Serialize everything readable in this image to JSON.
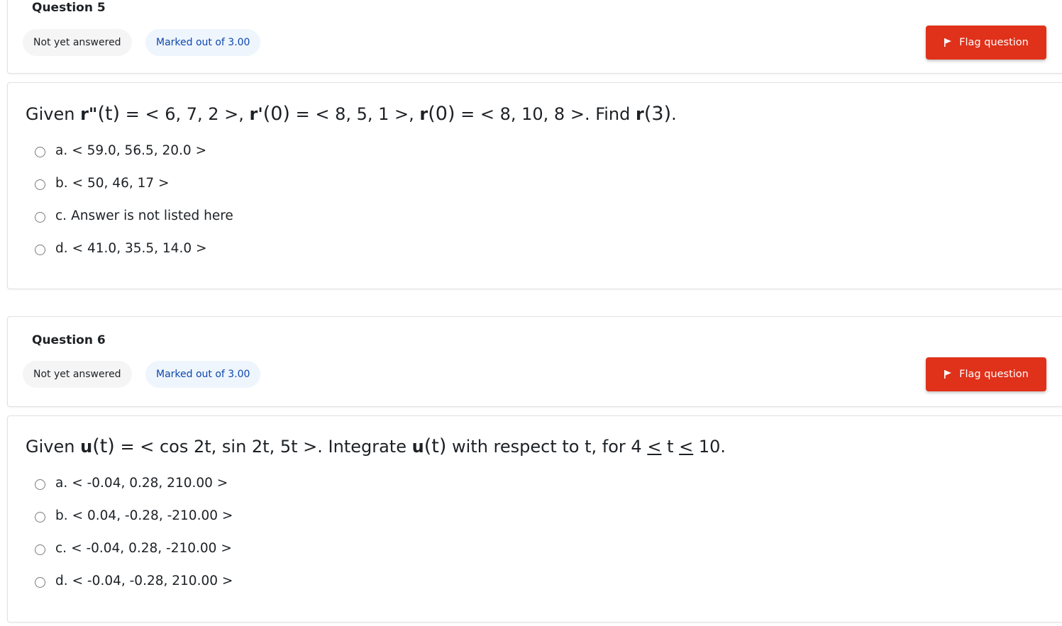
{
  "q5": {
    "title": "Question 5",
    "state": "Not yet answered",
    "marks": "Marked out of 3.00",
    "flag_label": "Flag question",
    "text": {
      "given": "Given",
      "r2": "r\"",
      "t1": "(t)",
      "eq1": " = < 6, 7, 2 >,",
      "r1": "r'",
      "t2": "(0)",
      "eq2": " = < 8, 5, 1 >,",
      "r0": "r",
      "t3": "(0)",
      "eq3": " = < 8, 10, 8 >. Find",
      "r3": "r",
      "t4": "(3)",
      "end": "."
    },
    "options": [
      {
        "letter": "a.",
        "text": "< 59.0, 56.5, 20.0 >"
      },
      {
        "letter": "b.",
        "text": "< 50, 46, 17 >"
      },
      {
        "letter": "c.",
        "text": "Answer is not listed here"
      },
      {
        "letter": "d.",
        "text": "< 41.0, 35.5, 14.0 >"
      }
    ]
  },
  "q6": {
    "title": "Question 6",
    "state": "Not yet answered",
    "marks": "Marked out of 3.00",
    "flag_label": "Flag question",
    "text": {
      "given": "Given",
      "u1": "u",
      "t1": "(t)",
      "eq1": " = < cos 2t, sin 2t, 5t >. Integrate",
      "u2": "u",
      "t2": "(t)",
      "mid": " with respect to t, for 4",
      "le1": "<",
      "tt": "t",
      "le2": "<",
      "end": "10."
    },
    "options": [
      {
        "letter": "a.",
        "text": "< -0.04, 0.28, 210.00 >"
      },
      {
        "letter": "b.",
        "text": "< 0.04, -0.28, -210.00 >"
      },
      {
        "letter": "c.",
        "text": "< -0.04, 0.28, -210.00 >"
      },
      {
        "letter": "d.",
        "text": "< -0.04, -0.28, 210.00 >"
      }
    ]
  },
  "colors": {
    "flag_bg": "#e0311a",
    "marks_text": "#0f47ad",
    "marks_bg": "#eef5fd",
    "state_bg": "#f5f5f5"
  },
  "icons": {
    "flag": "flag-icon",
    "radio": "radio-circle-icon"
  }
}
